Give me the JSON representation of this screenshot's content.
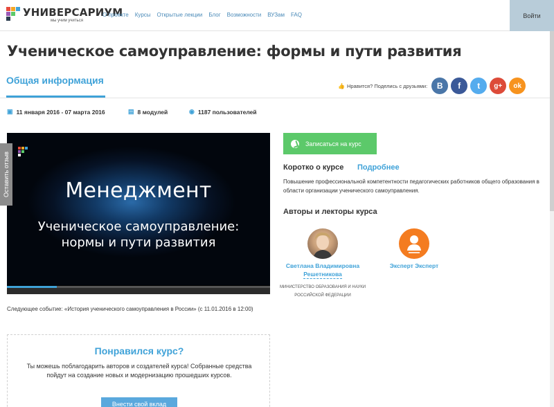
{
  "header": {
    "logo_text": "УНИВЕРСАРИУМ",
    "logo_sub": "мы учим учиться",
    "nav": [
      "О проекте",
      "Курсы",
      "Открытые лекции",
      "Блог",
      "Возможности",
      "ВУЗам",
      "FAQ"
    ],
    "login": "Войти"
  },
  "page": {
    "title": "Ученическое самоуправление: формы и пути развития",
    "tab_active": "Общая информация"
  },
  "share": {
    "label": "Нравится? Поделись с друзьями:",
    "buttons": [
      {
        "name": "vk",
        "glyph": "В",
        "color": "#4a76a8"
      },
      {
        "name": "facebook",
        "glyph": "f",
        "color": "#3b5998"
      },
      {
        "name": "twitter",
        "glyph": "t",
        "color": "#55acee"
      },
      {
        "name": "google-plus",
        "glyph": "g+",
        "color": "#dd4b39"
      },
      {
        "name": "odnoklassniki",
        "glyph": "ok",
        "color": "#f7931e"
      }
    ]
  },
  "meta": {
    "dates": "11 января 2016 - 07 марта 2016",
    "modules": "8 модулей",
    "users": "1187 пользователей"
  },
  "video": {
    "title": "Менеджмент",
    "subtitle_line1": "Ученическое самоуправление:",
    "subtitle_line2": "нормы и пути развития",
    "progress_fraction": 0.19
  },
  "next_event": "Следующее событие: «История ученического самоуправления в России» (с 11.01.2016 в 12:00)",
  "liked": {
    "title": "Понравился курс?",
    "text": "Ты можешь поблагодарить авторов и создателей курса! Собранные средства пойдут на создание новых и модернизацию прошедших курсов.",
    "button": "Внести свой вклад"
  },
  "enroll": {
    "label": "Записаться на курс"
  },
  "short": {
    "heading": "Коротко о курсе",
    "more": "Подробнее",
    "text": "Повышение профессиональной компетентности педагогических работников общего образования в области организации ученического самоуправления."
  },
  "authors": {
    "heading": "Авторы и лекторы курса",
    "items": [
      {
        "name_line1": "Светлана Владимировна",
        "name_line2": "Решетникова",
        "org": "МИНИСТЕРСТВО ОБРАЗОВАНИЯ И НАУКИ РОССИЙСКОЙ ФЕДЕРАЦИИ"
      },
      {
        "name_line1": "Эксперт Эксперт",
        "name_line2": "",
        "org": ""
      }
    ]
  },
  "feedback": "Оставить отзыв",
  "colors": {
    "accent": "#3fa2d8",
    "enroll": "#5cc96a",
    "login_bg": "#b8ccd9"
  }
}
